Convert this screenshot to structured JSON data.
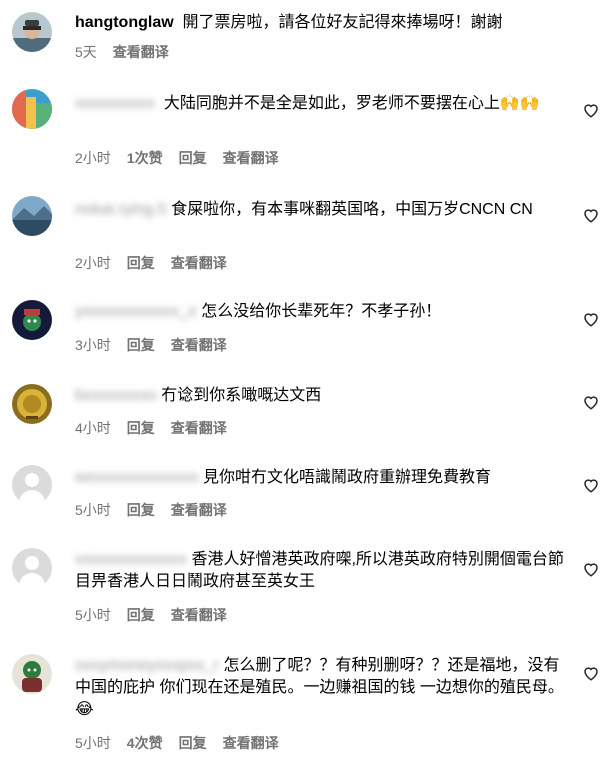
{
  "comments": [
    {
      "user": "hangtonglaw",
      "user_blurred": false,
      "text": "開了票房啦，請各位好友記得來捧場呀！謝謝",
      "time": "5天",
      "likes": "",
      "reply": "",
      "translate": "查看翻译",
      "heart": false
    },
    {
      "user": "xxxxxxxxxx",
      "user_blurred": true,
      "text": "大陆同胞并不是全是如此，罗老师不要摆在心上🙌🙌",
      "time": "2小时",
      "likes": "1次赞",
      "reply": "回复",
      "translate": "查看翻译",
      "heart": true
    },
    {
      "user": "nokat.rying.5",
      "user_blurred": true,
      "text": "食屎啦你，有本事咪翻英国咯，中国万岁CNCN CN",
      "time": "2小时",
      "likes": "",
      "reply": "回复",
      "translate": "查看翻译",
      "heart": true
    },
    {
      "user": "yxxxxxxxxxxxx_o",
      "user_blurred": true,
      "text": "怎么没给你长辈死年？不孝子孙！",
      "time": "3小时",
      "likes": "",
      "reply": "回复",
      "translate": "查看翻译",
      "heart": true
    },
    {
      "user": "bxxxxxxxxo",
      "user_blurred": true,
      "text": "冇谂到你系噉嘅达文西",
      "time": "4小时",
      "likes": "",
      "reply": "回复",
      "translate": "查看翻译",
      "heart": true
    },
    {
      "user": "wxxxxxxxxxxxxxx",
      "user_blurred": true,
      "text": "見你咁冇文化唔識鬧政府重辦理免費教育",
      "time": "5小时",
      "likes": "",
      "reply": "回复",
      "translate": "查看翻译",
      "heart": true
    },
    {
      "user": "vxxxxxxxxxxxxx",
      "user_blurred": true,
      "text": "香港人好憎港英政府㗎,所以港英政府特別開個電台節目畀香港人日日鬧政府甚至英女王",
      "time": "5小时",
      "likes": "",
      "reply": "回复",
      "translate": "查看翻译",
      "heart": true
    },
    {
      "user": "oxxymoneyxxxpxx_r",
      "user_blurred": true,
      "text": "怎么删了呢？？有种别删呀？？还是福地，没有中国的庇护 你们现在还是殖民。一边赚祖国的钱 一边想你的殖民母。😂",
      "time": "5小时",
      "likes": "4次赞",
      "reply": "回复",
      "translate": "查看翻译",
      "heart": true
    }
  ],
  "colors": {
    "meta": "#737373",
    "placeholder_avatar": "#dbdbdb"
  }
}
